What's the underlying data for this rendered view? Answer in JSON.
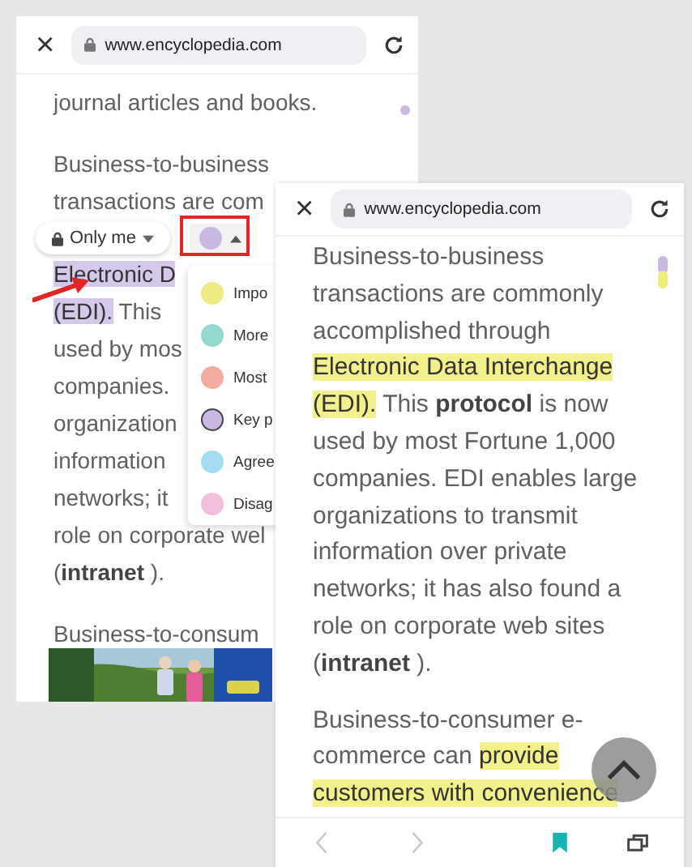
{
  "left_window": {
    "close": "×",
    "url": "www.encyclopedia.com",
    "paragraphs": [
      {
        "lines": [
          [
            {
              "text": "journal articles and books.",
              "kind": "plain"
            }
          ]
        ]
      },
      {
        "lines": [
          [
            {
              "text": "Business-to-business",
              "kind": "plain"
            }
          ],
          [
            {
              "text": "transactions are com",
              "kind": "plain"
            }
          ],
          [
            {
              "kind": "toolbar"
            }
          ],
          [
            {
              "text": "Electronic D",
              "kind": "mark",
              "color": "#d5c8ea"
            }
          ],
          [
            {
              "text": "(EDI).",
              "kind": "mark",
              "color": "#d5c8ea"
            },
            {
              "text": " This",
              "kind": "plain"
            }
          ],
          [
            {
              "text": "used by mos",
              "kind": "plain"
            }
          ],
          [
            {
              "text": "companies.",
              "kind": "plain"
            }
          ],
          [
            {
              "text": "organization",
              "kind": "plain"
            }
          ],
          [
            {
              "text": "information",
              "kind": "plain"
            }
          ],
          [
            {
              "text": "networks; it",
              "kind": "plain"
            }
          ],
          [
            {
              "text": "role on corporate wel",
              "kind": "plain"
            }
          ],
          [
            {
              "text": "(",
              "kind": "plain"
            },
            {
              "text": "intranet",
              "kind": "bold"
            },
            {
              "text": " ).",
              "kind": "plain"
            }
          ]
        ]
      },
      {
        "lines": [
          [
            {
              "text": "Business-to-consum",
              "kind": "plain"
            }
          ]
        ]
      }
    ],
    "toolbar": {
      "privacy": "Only me",
      "color": "#c8b8e4"
    },
    "dropdown": [
      {
        "label": "Impo",
        "color": "#eeeb85",
        "selected": false
      },
      {
        "label": "More",
        "color": "#95d8cf",
        "selected": false
      },
      {
        "label": "Most",
        "color": "#f4aba0",
        "selected": false
      },
      {
        "label": "Key p",
        "color": "#c8b8e4",
        "selected": true
      },
      {
        "label": "Agree",
        "color": "#a6dcf2",
        "selected": false
      },
      {
        "label": "Disag",
        "color": "#f2bfdc",
        "selected": false
      }
    ]
  },
  "right_window": {
    "close": "×",
    "url": "www.encyclopedia.com",
    "paragraphs": [
      {
        "lines": [
          [
            {
              "text": "Business-to-business",
              "kind": "plain"
            }
          ],
          [
            {
              "text": "transactions are commonly",
              "kind": "plain"
            }
          ],
          [
            {
              "text": "accomplished through",
              "kind": "plain"
            }
          ],
          [
            {
              "text": "Electronic Data Interchange",
              "kind": "mark",
              "color": "#f2f08a"
            }
          ],
          [
            {
              "text": "(EDI).",
              "kind": "mark",
              "color": "#f2f08a"
            },
            {
              "text": " This ",
              "kind": "plain"
            },
            {
              "text": "protocol",
              "kind": "bold"
            },
            {
              "text": " is now",
              "kind": "plain"
            }
          ],
          [
            {
              "text": "used by most Fortune 1,000",
              "kind": "plain"
            }
          ],
          [
            {
              "text": "companies. EDI enables large",
              "kind": "plain"
            }
          ],
          [
            {
              "text": "organizations to transmit",
              "kind": "plain"
            }
          ],
          [
            {
              "text": "information over private",
              "kind": "plain"
            }
          ],
          [
            {
              "text": "networks; it has also found a",
              "kind": "plain"
            }
          ],
          [
            {
              "text": "role on corporate web sites",
              "kind": "plain"
            }
          ],
          [
            {
              "text": "(",
              "kind": "plain"
            },
            {
              "text": "intranet",
              "kind": "bold"
            },
            {
              "text": " ).",
              "kind": "plain"
            }
          ]
        ]
      },
      {
        "lines": [
          [
            {
              "text": "Business-to-consumer e-",
              "kind": "plain"
            }
          ],
          [
            {
              "text": "commerce can ",
              "kind": "plain"
            },
            {
              "text": "provide",
              "kind": "mark",
              "color": "#f2f08a"
            }
          ],
          [
            {
              "text": "customers with convenience",
              "kind": "mark",
              "color": "#f2f08a"
            }
          ]
        ]
      }
    ],
    "nav": [
      {
        "kind": "back",
        "disabled": true
      },
      {
        "kind": "forward",
        "disabled": true
      },
      {
        "kind": "bookmark",
        "disabled": false
      },
      {
        "kind": "tabs",
        "disabled": false
      }
    ]
  }
}
